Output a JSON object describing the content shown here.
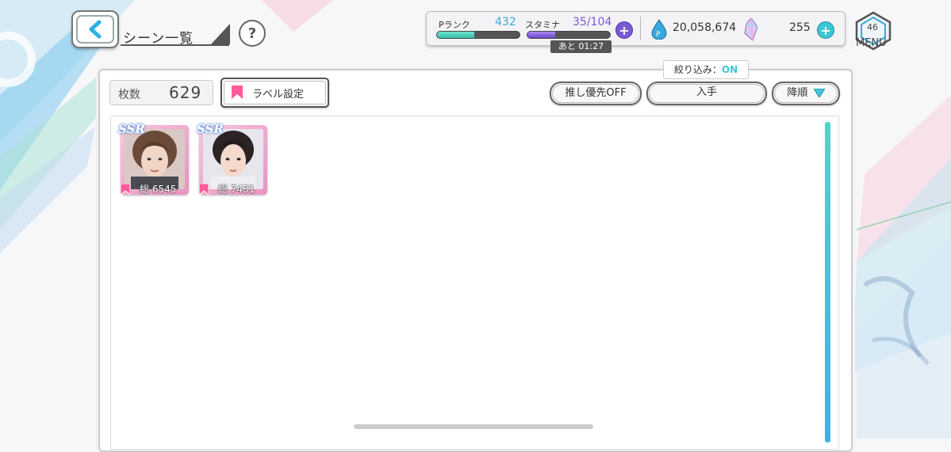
{
  "header": {
    "title": "シーン一覧",
    "help_symbol": "?"
  },
  "status": {
    "prank_label": "Pランク",
    "prank_value": "432",
    "prank_progress": 0.45,
    "stamina_label": "スタミナ",
    "stamina_current": "35",
    "stamina_sep": "/",
    "stamina_max": "104",
    "stamina_progress": 0.34,
    "stamina_timer": "あと 01:27",
    "currency_value": "20,058,674",
    "gem_value": "255",
    "level": "46",
    "menu_label": "MENU"
  },
  "toolbar": {
    "count_label": "枚数",
    "count_value": "629",
    "label_settings": "ラベル設定",
    "oshi_priority": "推し優先OFF",
    "filter_tag_label": "絞り込み：",
    "filter_tag_state": "ON",
    "sort_key": "入手",
    "sort_order": "降順"
  },
  "cards": [
    {
      "rarity": "SSR",
      "stat": "総 6545"
    },
    {
      "rarity": "SSR",
      "stat": "総 7431"
    }
  ],
  "colors": {
    "accent_cyan": "#3ec6d6",
    "stamina_purple": "#7a5bd6",
    "label_pink": "#ff5b9a"
  }
}
